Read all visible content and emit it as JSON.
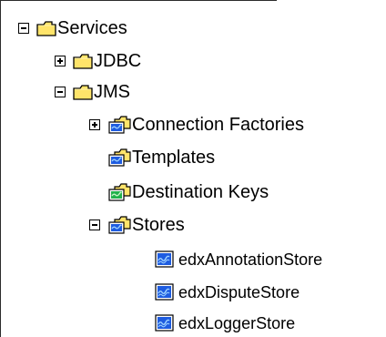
{
  "tree": {
    "services": {
      "label": "Services",
      "icon": "folder-icon",
      "expanded": true
    },
    "jdbc": {
      "label": "JDBC",
      "icon": "folder-icon",
      "expanded": false
    },
    "jms": {
      "label": "JMS",
      "icon": "folder-icon",
      "expanded": true
    },
    "connection_factories": {
      "label": "Connection Factories",
      "icon": "jms-folder-icon",
      "expanded": false
    },
    "templates": {
      "label": "Templates",
      "icon": "jms-folder-icon"
    },
    "destination_keys": {
      "label": "Destination Keys",
      "icon": "destination-keys-icon"
    },
    "stores": {
      "label": "Stores",
      "icon": "jms-folder-icon",
      "expanded": true
    },
    "stores_items": [
      {
        "label": "edxAnnotationStore",
        "icon": "store-icon"
      },
      {
        "label": "edxDisputeStore",
        "icon": "store-icon"
      },
      {
        "label": "edxLoggerStore",
        "icon": "store-icon"
      }
    ]
  },
  "colors": {
    "folder_fill": "#FFE46A",
    "folder_border": "#000000",
    "store_fill": "#1E5CE0",
    "store_wave": "#9FD3FF",
    "green": "#22B14C"
  }
}
